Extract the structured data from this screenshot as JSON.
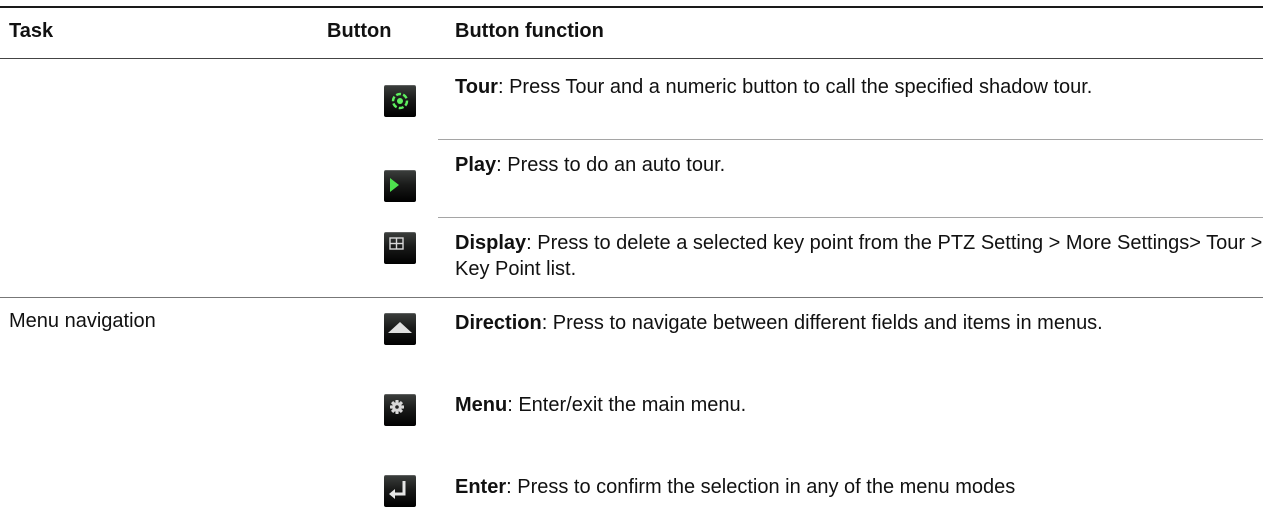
{
  "header": {
    "task": "Task",
    "button": "Button",
    "function": "Button function"
  },
  "rows": [
    {
      "task": "",
      "icon": "tour-icon",
      "name": "Tour",
      "text": ": Press Tour and a numeric button to call the specified shadow tour."
    },
    {
      "task": "",
      "icon": "play-icon",
      "name": "Play",
      "text": ": Press to do an auto tour."
    },
    {
      "task": "",
      "icon": "display-icon",
      "name": "Display",
      "text": ": Press to delete a selected key point from the PTZ Setting > More Settings> Tour > Key Point list."
    },
    {
      "task": "Menu navigation",
      "icon": "direction-icon",
      "name": "Direction",
      "text": ": Press to navigate between different fields and items in menus."
    },
    {
      "task": "",
      "icon": "menu-gear-icon",
      "name": "Menu",
      "text": ": Enter/exit the main menu."
    },
    {
      "task": "",
      "icon": "enter-icon",
      "name": "Enter",
      "text": ": Press to confirm the selection in any of the menu modes"
    }
  ],
  "colors": {
    "accent_green": "#4ee24e",
    "icon_bg_dark": "#000000",
    "icon_glyph_light": "#d8d8d8"
  }
}
